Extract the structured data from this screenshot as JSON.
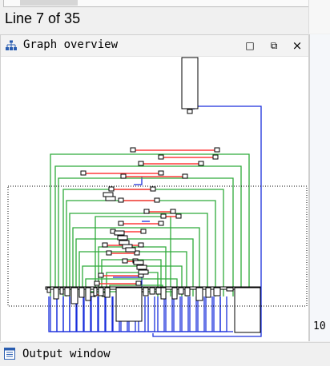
{
  "editor": {
    "line_status": "Line 7 of 35",
    "side_number": "10"
  },
  "graph_panel": {
    "title": "Graph overview",
    "icon": "graph-hierarchy-icon",
    "buttons": {
      "maximize": "□",
      "restore": "⧉",
      "close": "×"
    }
  },
  "output_panel": {
    "title": "Output window",
    "icon": "document-icon"
  },
  "colors": {
    "edge_green": "#2eaa3a",
    "edge_red": "#ff3b3b",
    "edge_blue": "#1a2fdc",
    "node_border": "#000000",
    "viewport_dots": "#000000"
  }
}
